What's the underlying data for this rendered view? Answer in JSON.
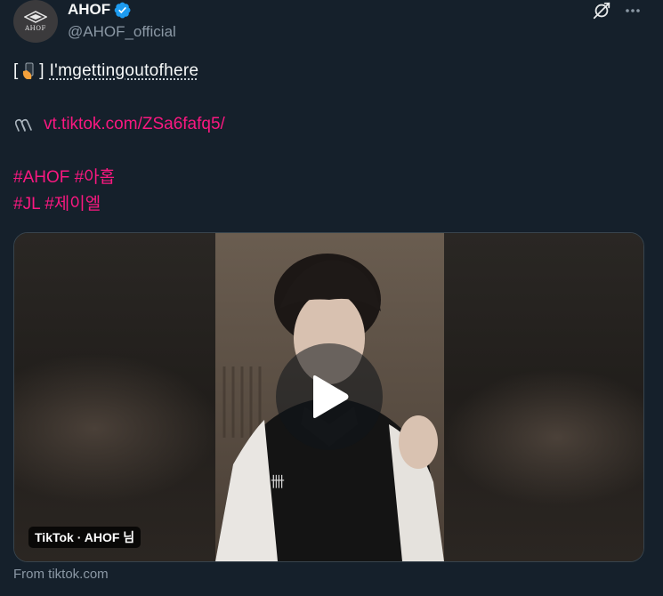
{
  "author": {
    "display_name": "AHOF",
    "handle": "@AHOF_official",
    "avatar_text": "AHOF",
    "verified": true
  },
  "tweet": {
    "line1_open": "[",
    "line1_close": "]",
    "line1_text": "I'mgettingoutofhere",
    "link_text": "vt.tiktok.com/ZSa6fafq5/",
    "hashtags_line1": "#AHOF #아홉",
    "hashtags_line2": "#JL #제이엘"
  },
  "media": {
    "source_badge": "TikTok · AHOF 님",
    "from_label": "From tiktok.com"
  },
  "icons": {
    "grok": "grok-icon",
    "more": "more-icon",
    "verified": "verified-badge-icon",
    "paperclip": "paperclip-icon",
    "phone": "phone-emoji-icon",
    "play": "play-icon"
  },
  "colors": {
    "background": "#15202b",
    "link": "#f91880",
    "secondary_text": "#8b98a5",
    "verified": "#1d9bf0"
  }
}
